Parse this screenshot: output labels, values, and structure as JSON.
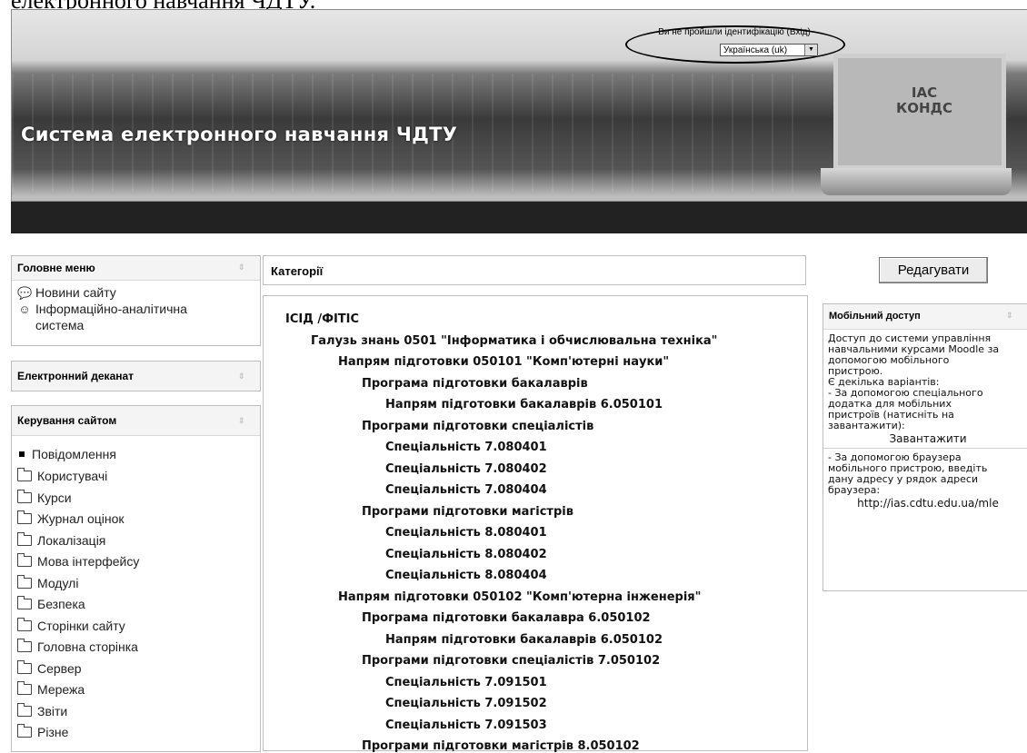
{
  "top_cut_text": "електронного навчання ЧДТУ.",
  "header": {
    "site_title": "Система електронного навчання ЧДТУ",
    "login_text": "Ви не пройшли ідентифікацію (Вхід)",
    "language": "Українська (uk)",
    "laptop_logo": "ІАС\nКОНДС"
  },
  "main_menu": {
    "title": "Головне меню",
    "items": [
      "Новини сайту",
      "Інформаційно-аналітична",
      "система"
    ]
  },
  "dean_block": {
    "title": "Електронний деканат"
  },
  "admin_block": {
    "title": "Керування сайтом",
    "first_item": "Повідомлення",
    "items": [
      "Користувачі",
      "Курси",
      "Журнал оцінок",
      "Локалізація",
      "Мова інтерфейсу",
      "Модулі",
      "Безпека",
      "Сторінки сайту",
      "Головна сторінка",
      "Сервер",
      "Мережа",
      "Звіти",
      "Різне"
    ]
  },
  "categories": {
    "title": "Категорії",
    "rows": [
      "ІСІД /ФІТІС",
      "Галузь знань 0501 \"Інформатика і обчислювальна техніка\"",
      "Напрям підготовки 050101 \"Комп'ютерні науки\"",
      "Програма підготовки бакалаврів",
      "Напрям підготовки бакалаврів 6.050101",
      "Програми підготовки спеціалістів",
      "Спеціальність 7.080401",
      "Спеціальність 7.080402",
      "Спеціальність 7.080404",
      "Програми підготовки магістрів",
      "Спеціальність 8.080401",
      "Спеціальність 8.080402",
      "Спеціальність 8.080404",
      "Напрям підготовки 050102 \"Комп'ютерна інженерія\"",
      "Програма підготовки бакалавра 6.050102",
      "Напрям підготовки бакалаврів 6.050102",
      "Програми підготовки спеціалістів 7.050102",
      "Спеціальність 7.091501",
      "Спеціальність 7.091502",
      "Спеціальність 7.091503",
      "Програми підготовки магістрів 8.050102"
    ]
  },
  "edit_button": "Редагувати",
  "mobile": {
    "title": "Мобільний доступ",
    "lines1": [
      "Доступ до системи управління",
      "навчальними курсами Moodle за",
      "допомогою мобільного",
      "пристрою.",
      "Є декілька варіантів:",
      "- За допомогою спеціального",
      "додатка для мобільних",
      "пристроїв (натисніть на",
      "завантажити):"
    ],
    "download": "Завантажити",
    "lines2": [
      "- За допомогою браузера",
      "мобільного пристрою, введіть",
      "дану адресу у рядок адреси",
      "браузера:"
    ],
    "url": "http://ias.cdtu.edu.ua/mle"
  }
}
